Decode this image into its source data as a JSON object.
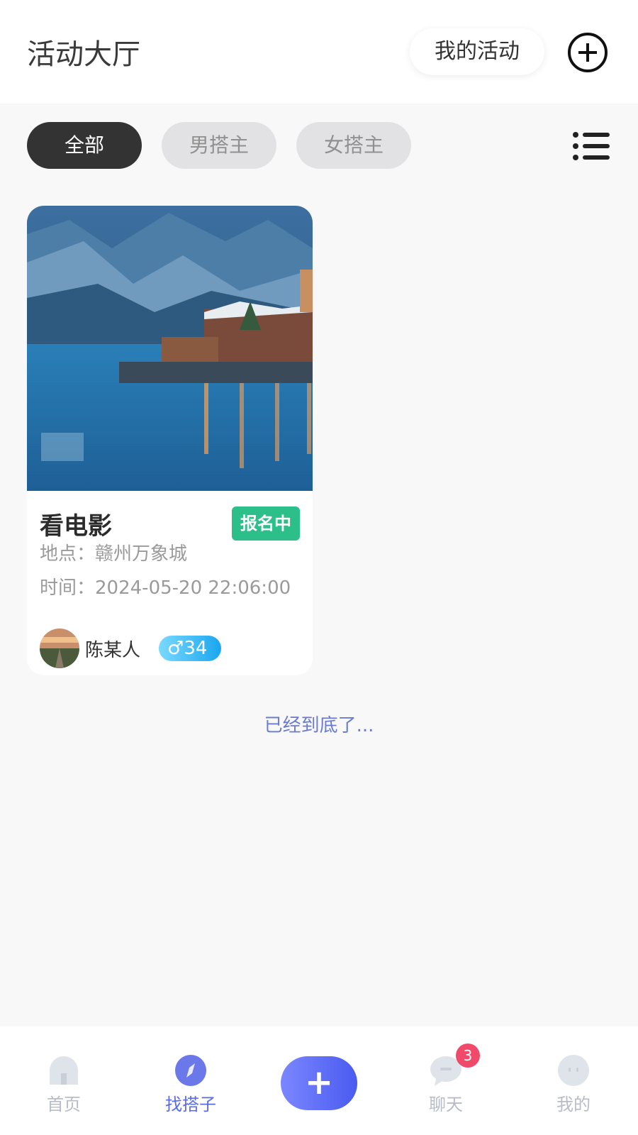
{
  "header": {
    "title": "活动大厅",
    "my_activity_label": "我的活动"
  },
  "filters": {
    "items": [
      {
        "label": "全部",
        "active": true
      },
      {
        "label": "男搭主",
        "active": false
      },
      {
        "label": "女搭主",
        "active": false
      }
    ]
  },
  "cards": [
    {
      "title": "看电影",
      "status": "报名中",
      "location_label": "地点：",
      "location": "赣州万象城",
      "time_label": "时间：",
      "time": "2024-05-20 22:06:00",
      "owner": "陈某人",
      "gender_symbol": "♂",
      "age": "34"
    }
  ],
  "end_text": "已经到底了...",
  "tabbar": {
    "items": [
      {
        "label": "首页",
        "icon": "home-icon"
      },
      {
        "label": "找搭子",
        "icon": "compass-icon",
        "active": true
      },
      {
        "label": "",
        "icon": "plus-icon"
      },
      {
        "label": "聊天",
        "icon": "chat-icon",
        "badge": "3"
      },
      {
        "label": "我的",
        "icon": "profile-icon"
      }
    ]
  },
  "colors": {
    "accent": "#5a6be6",
    "status_green": "#2cbf8a",
    "badge_red": "#ef4a6a"
  }
}
